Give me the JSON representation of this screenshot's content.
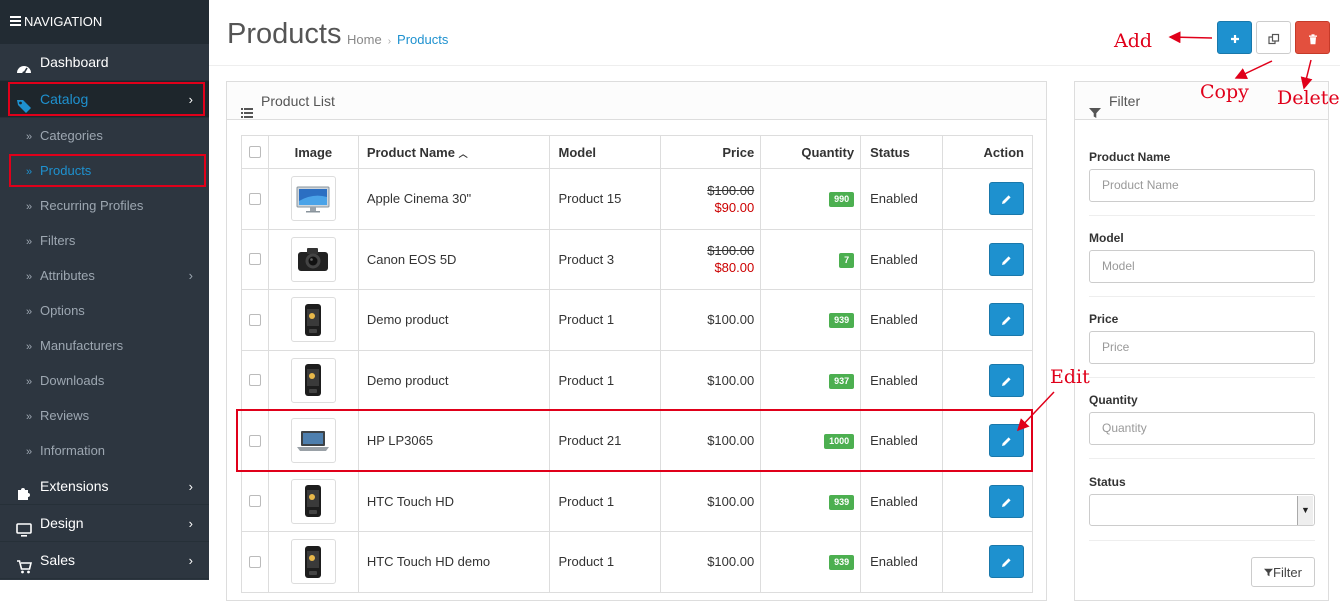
{
  "sidebar": {
    "heading": "NAVIGATION",
    "items": [
      {
        "label": "Dashboard",
        "icon": "dashboard-icon"
      },
      {
        "label": "Catalog",
        "icon": "tag-icon"
      },
      {
        "label": "Categories"
      },
      {
        "label": "Products"
      },
      {
        "label": "Recurring Profiles"
      },
      {
        "label": "Filters"
      },
      {
        "label": "Attributes"
      },
      {
        "label": "Options"
      },
      {
        "label": "Manufacturers"
      },
      {
        "label": "Downloads"
      },
      {
        "label": "Reviews"
      },
      {
        "label": "Information"
      },
      {
        "label": "Extensions",
        "icon": "puzzle-icon"
      },
      {
        "label": "Design",
        "icon": "monitor-icon"
      },
      {
        "label": "Sales",
        "icon": "cart-icon"
      }
    ]
  },
  "header": {
    "title": "Products",
    "breadcrumb": {
      "home": "Home",
      "current": "Products"
    }
  },
  "list": {
    "title": "Product List",
    "columns": {
      "image": "Image",
      "name": "Product Name",
      "model": "Model",
      "price": "Price",
      "quantity": "Quantity",
      "status": "Status",
      "action": "Action"
    },
    "rows": [
      {
        "name": "Apple Cinema 30\"",
        "model": "Product 15",
        "price": "$100.00",
        "special": "$90.00",
        "qty": "990",
        "status": "Enabled",
        "thumb": "monitor"
      },
      {
        "name": "Canon EOS 5D",
        "model": "Product 3",
        "price": "$100.00",
        "special": "$80.00",
        "qty": "7",
        "status": "Enabled",
        "thumb": "camera"
      },
      {
        "name": "Demo product",
        "model": "Product 1",
        "price": "$100.00",
        "qty": "939",
        "status": "Enabled",
        "thumb": "phone"
      },
      {
        "name": "Demo product",
        "model": "Product 1",
        "price": "$100.00",
        "qty": "937",
        "status": "Enabled",
        "thumb": "phone"
      },
      {
        "name": "HP LP3065",
        "model": "Product 21",
        "price": "$100.00",
        "qty": "1000",
        "status": "Enabled",
        "thumb": "laptop"
      },
      {
        "name": "HTC Touch HD",
        "model": "Product 1",
        "price": "$100.00",
        "qty": "939",
        "status": "Enabled",
        "thumb": "phone"
      },
      {
        "name": "HTC Touch HD demo",
        "model": "Product 1",
        "price": "$100.00",
        "qty": "939",
        "status": "Enabled",
        "thumb": "phone"
      }
    ]
  },
  "filter": {
    "title": "Filter",
    "fields": [
      {
        "label": "Product Name",
        "placeholder": "Product Name"
      },
      {
        "label": "Model",
        "placeholder": "Model"
      },
      {
        "label": "Price",
        "placeholder": "Price"
      },
      {
        "label": "Quantity",
        "placeholder": "Quantity"
      }
    ],
    "status_label": "Status",
    "status_value": "",
    "button": "Filter"
  },
  "annotations": {
    "add": "Add",
    "copy": "Copy",
    "delete": "Delete",
    "edit": "Edit"
  },
  "colors": {
    "primary": "#1e91cf",
    "danger": "#e3503e",
    "success": "#4caf50",
    "sidebar": "#2d3640",
    "annotation": "#e0001a"
  }
}
